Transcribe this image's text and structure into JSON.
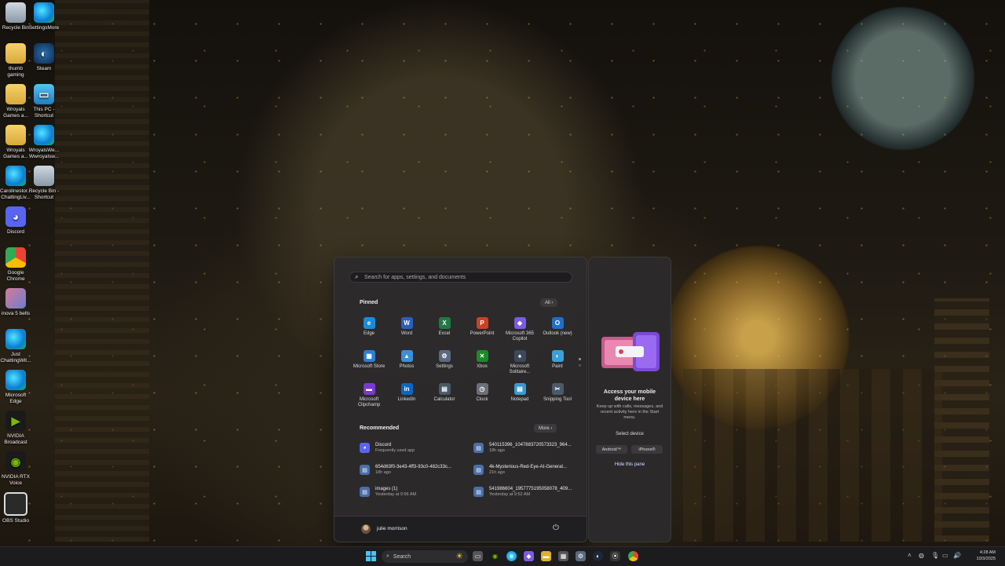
{
  "desktop": {
    "icons": [
      {
        "label": "Recycle Bin",
        "icon": "recycle-bin-icon"
      },
      {
        "label": "SettingsMore",
        "icon": "edge-icon"
      },
      {
        "label": "thumb gaming",
        "icon": "folder-icon"
      },
      {
        "label": "Steam",
        "icon": "steam-icon"
      },
      {
        "label": "Wroyals Games a...",
        "icon": "folder-icon"
      },
      {
        "label": "This PC - Shortcut",
        "icon": "pc-icon"
      },
      {
        "label": "Wroyals Games a...",
        "icon": "folder-icon"
      },
      {
        "label": "WroyalsWe... Wwroyalsw...",
        "icon": "edge-icon"
      },
      {
        "label": "Carolinestor... ChattingLiv...",
        "icon": "edge-icon"
      },
      {
        "label": "Recycle Bin - Shortcut",
        "icon": "recycle-bin-icon"
      },
      {
        "label": "Discord",
        "icon": "discord-icon"
      },
      {
        "label": "Google Chrome",
        "icon": "chrome-icon"
      },
      {
        "label": "inova 5 bells",
        "icon": "image-icon"
      },
      {
        "label": "Just ChattingWit...",
        "icon": "edge-icon"
      },
      {
        "label": "Microsoft Edge",
        "icon": "edge-icon"
      },
      {
        "label": "NVIDIA Broadcast",
        "icon": "nvidia-icon"
      },
      {
        "label": "NVIDIA RTX Voice",
        "icon": "nvidia-voice-icon"
      },
      {
        "label": "OBS Studio",
        "icon": "obs-icon"
      }
    ]
  },
  "start_menu": {
    "search_placeholder": "Search for apps, settings, and documents",
    "pinned_title": "Pinned",
    "all_button": "All  ›",
    "pinned": [
      {
        "label": "Edge",
        "color": "#1c8bd6",
        "glyph": "e"
      },
      {
        "label": "Word",
        "color": "#2b5fb8",
        "glyph": "W"
      },
      {
        "label": "Excel",
        "color": "#1f7a44",
        "glyph": "X"
      },
      {
        "label": "PowerPoint",
        "color": "#c94425",
        "glyph": "P"
      },
      {
        "label": "Microsoft 365 Copilot",
        "color": "#7b5be0",
        "glyph": "◆"
      },
      {
        "label": "Outlook (new)",
        "color": "#1e6fc8",
        "glyph": "O"
      },
      {
        "label": "Microsoft Store",
        "color": "#2d7fd0",
        "glyph": "▦"
      },
      {
        "label": "Photos",
        "color": "#3b8fd8",
        "glyph": "▲"
      },
      {
        "label": "Settings",
        "color": "#5a6b80",
        "glyph": "⚙"
      },
      {
        "label": "Xbox",
        "color": "#1c8a2a",
        "glyph": "✕"
      },
      {
        "label": "Microsoft Solitaire...",
        "color": "#3a4a5a",
        "glyph": "♠"
      },
      {
        "label": "Paint",
        "color": "#3aa0d8",
        "glyph": "◐"
      },
      {
        "label": "Microsoft Clipchamp",
        "color": "#7a3ad0",
        "glyph": "▬"
      },
      {
        "label": "LinkedIn",
        "color": "#0a66c2",
        "glyph": "in"
      },
      {
        "label": "Calculator",
        "color": "#4a5866",
        "glyph": "▤"
      },
      {
        "label": "Clock",
        "color": "#6a7078",
        "glyph": "◷"
      },
      {
        "label": "Notepad",
        "color": "#3a9ad0",
        "glyph": "▤"
      },
      {
        "label": "Snipping Tool",
        "color": "#4a5a6a",
        "glyph": "✂"
      }
    ],
    "recommended_title": "Recommended",
    "more_button": "More  ›",
    "recommended": [
      {
        "name": "Discord",
        "sub": "Frequently used app",
        "color": "#5865f2"
      },
      {
        "name": "540115396_1047883720573323_964...",
        "sub": "18h ago",
        "color": "#4a6fa8"
      },
      {
        "name": "654d63f0-3e43-4ff3-93c0-482c33c...",
        "sub": "18h ago",
        "color": "#4a6fa8"
      },
      {
        "name": "4k-Mysterious-Red-Eye-AI-Generat...",
        "sub": "21h ago",
        "color": "#4a6fa8"
      },
      {
        "name": "images (1)",
        "sub": "Yesterday at 9:56 AM",
        "color": "#4a6fa8"
      },
      {
        "name": "541986604_1957775195058078_409...",
        "sub": "Yesterday at 9:52 AM",
        "color": "#4a6fa8"
      }
    ],
    "user_name": "julie morrison"
  },
  "phone_panel": {
    "title": "Access your mobile device here",
    "description": "Keep up with calls, messages, and recent activity here in the Start menu.",
    "select_label": "Select device",
    "android_button": "Android™",
    "iphone_button": "iPhone®",
    "hide_link": "Hide this pane"
  },
  "taskbar": {
    "search_label": "Search",
    "time": "4:28 AM",
    "date": "10/3/2025"
  }
}
